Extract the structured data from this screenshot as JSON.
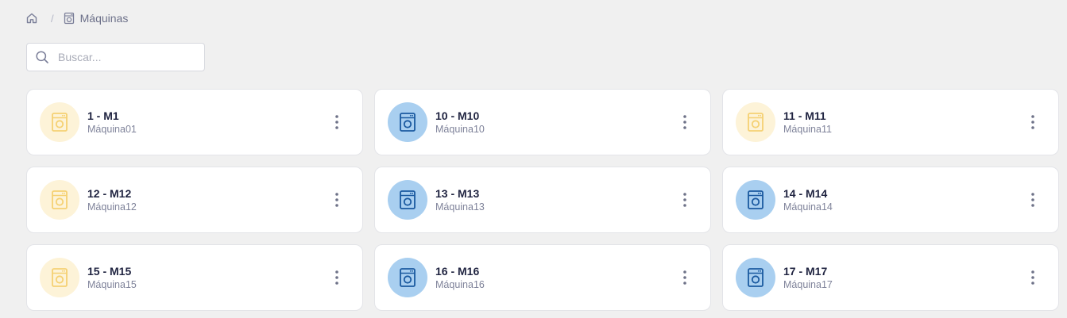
{
  "breadcrumb": {
    "home_icon": "home-icon",
    "separator": "/",
    "current_icon": "washing-machine-icon",
    "current_label": "Máquinas"
  },
  "search": {
    "placeholder": "Buscar...",
    "value": "",
    "icon": "search-icon"
  },
  "colors": {
    "yellow_bg": "#fdf3d8",
    "yellow_icon": "#f5d173",
    "blue_bg": "#a9cff0",
    "blue_icon": "#1b5aa0"
  },
  "machines": [
    {
      "title": "1 - M1",
      "subtitle": "Máquina01",
      "status": "yellow"
    },
    {
      "title": "10 - M10",
      "subtitle": "Máquina10",
      "status": "blue"
    },
    {
      "title": "11 - M11",
      "subtitle": "Máquina11",
      "status": "yellow"
    },
    {
      "title": "12 - M12",
      "subtitle": "Máquina12",
      "status": "yellow"
    },
    {
      "title": "13 - M13",
      "subtitle": "Máquina13",
      "status": "blue"
    },
    {
      "title": "14 - M14",
      "subtitle": "Máquina14",
      "status": "blue"
    },
    {
      "title": "15 - M15",
      "subtitle": "Máquina15",
      "status": "yellow"
    },
    {
      "title": "16 - M16",
      "subtitle": "Máquina16",
      "status": "blue"
    },
    {
      "title": "17 - M17",
      "subtitle": "Máquina17",
      "status": "blue"
    }
  ]
}
